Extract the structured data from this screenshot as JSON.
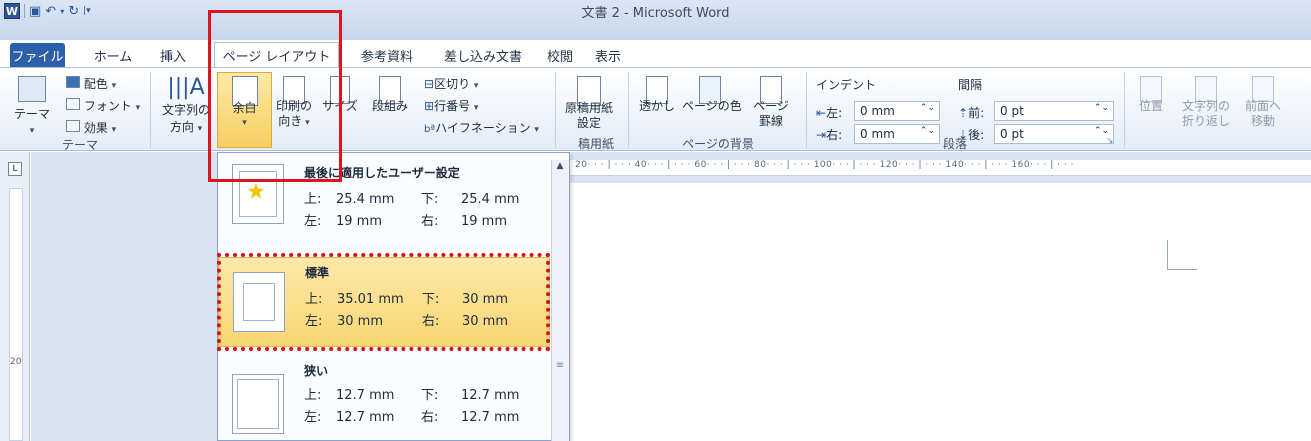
{
  "window": {
    "title": "文書 2 - Microsoft Word"
  },
  "tabs": [
    {
      "label": "ファイル"
    },
    {
      "label": "ホーム"
    },
    {
      "label": "挿入"
    },
    {
      "label": "ページ レイアウト"
    },
    {
      "label": "参考資料"
    },
    {
      "label": "差し込み文書"
    },
    {
      "label": "校閲"
    },
    {
      "label": "表示"
    }
  ],
  "ribbon": {
    "theme": {
      "colors": "配色",
      "fonts": "フォント",
      "effects": "効果",
      "theme_btn": "テーマ",
      "group": "テーマ"
    },
    "page_setup": {
      "text_direction_1": "文字列の",
      "text_direction_2": "方向",
      "margins": "余白",
      "orientation_1": "印刷の",
      "orientation_2": "向き",
      "size": "サイズ",
      "columns": "段組み",
      "breaks": "区切り",
      "line_numbers": "行番号",
      "hyphenation": "ハイフネーション"
    },
    "genko": {
      "label_1": "原稿用紙",
      "label_2": "設定",
      "group": "稿用紙"
    },
    "background": {
      "watermark": "透かし",
      "page_color": "ページの色",
      "page_borders_1": "ページ",
      "page_borders_2": "罫線",
      "group": "ページの背景"
    },
    "paragraph": {
      "indent_title": "インデント",
      "spacing_title": "間隔",
      "left_label": "左:",
      "left_value": "0 mm",
      "right_label": "右:",
      "right_value": "0 mm",
      "before_label": "前:",
      "before_value": "0 pt",
      "after_label": "後:",
      "after_value": "0 pt",
      "group": "段落"
    },
    "arrange": {
      "position": "位置",
      "wrap_1": "文字列の",
      "wrap_2": "折り返し",
      "forward_1": "前面へ",
      "forward_2": "移動"
    }
  },
  "margins_menu": {
    "items": [
      {
        "title": "最後に適用したユーザー設定",
        "top_label": "上:",
        "top": "25.4 mm",
        "bottom_label": "下:",
        "bottom": "25.4 mm",
        "left_label": "左:",
        "left": "19 mm",
        "right_label": "右:",
        "right": "19 mm"
      },
      {
        "title": "標準",
        "top_label": "上:",
        "top": "35.01 mm",
        "bottom_label": "下:",
        "bottom": "30 mm",
        "left_label": "左:",
        "left": "30 mm",
        "right_label": "右:",
        "right": "30 mm"
      },
      {
        "title": "狭い",
        "top_label": "上:",
        "top": "12.7 mm",
        "bottom_label": "下:",
        "bottom": "12.7 mm",
        "left_label": "左:",
        "left": "12.7 mm",
        "right_label": "右:",
        "right": "12.7 mm"
      }
    ]
  },
  "ruler": {
    "ticks": "20· · · | · · · 40· · · | · · · 60· · · | · · · 80· · · | · · · 100· · · | · · · 120· · · | · · · 140· · · | · · · 160· · · | · · ·",
    "v_mark": "20",
    "tab_btn": "L"
  }
}
